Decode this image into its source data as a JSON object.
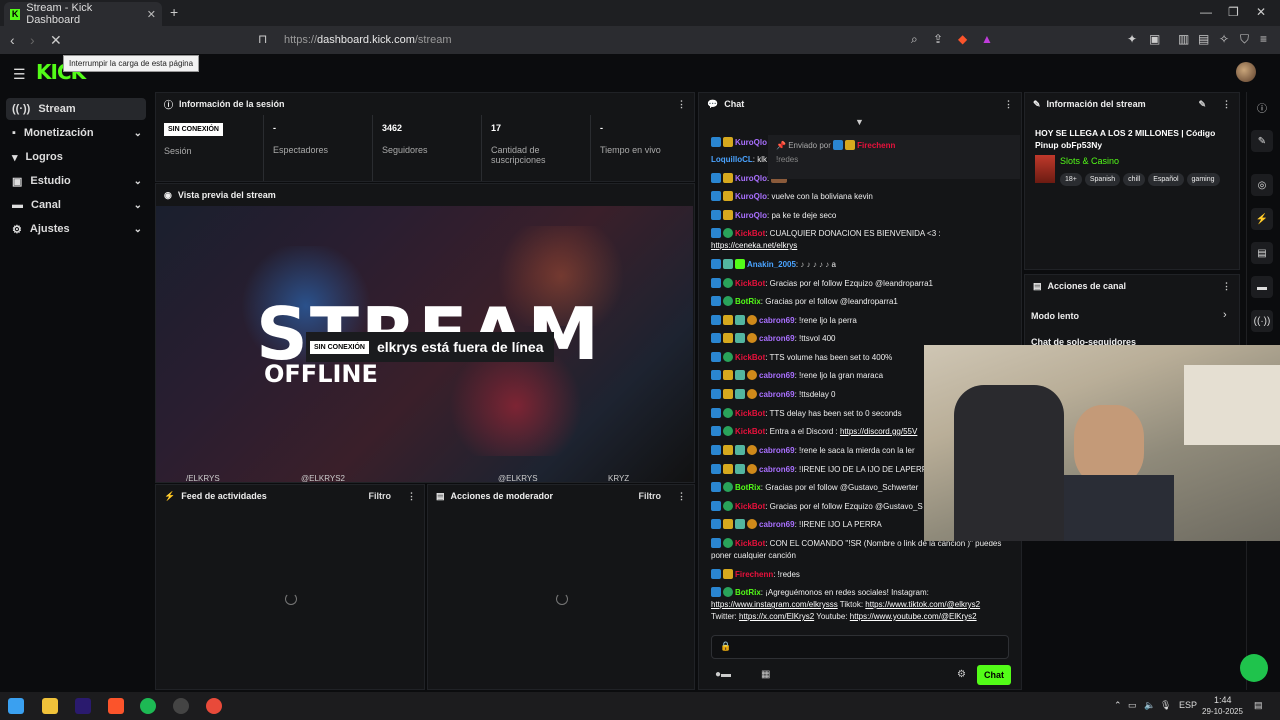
{
  "browser": {
    "tab_title": "Stream - Kick Dashboard",
    "url_prefix": "https://",
    "url_host": "dashboard.kick.com",
    "url_path": "/stream",
    "tooltip": "Interrumpir la carga de esta página"
  },
  "app": {
    "logo": "KICK"
  },
  "sidebar": {
    "items": [
      {
        "label": "Stream",
        "icon": "broadcast-icon",
        "active": true
      },
      {
        "label": "Monetización",
        "icon": "money-icon",
        "expandable": true
      },
      {
        "label": "Logros",
        "icon": "trophy-icon"
      },
      {
        "label": "Estudio",
        "icon": "studio-icon",
        "expandable": true
      },
      {
        "label": "Canal",
        "icon": "channel-icon",
        "expandable": true
      },
      {
        "label": "Ajustes",
        "icon": "gear-icon",
        "expandable": true
      }
    ]
  },
  "session": {
    "title": "Información de la sesión",
    "status_badge": "SIN CONEXIÓN",
    "status_label": "Sesión",
    "viewers_value": "-",
    "viewers_label": "Espectadores",
    "followers_value": "3462",
    "followers_label": "Seguidores",
    "subs_value": "17",
    "subs_label": "Cantidad de suscripciones",
    "live_value": "-",
    "live_label": "Tiempo en vivo"
  },
  "preview": {
    "title": "Vista previa del stream",
    "big_text": "STREAM",
    "big_sub": "OFFLINE",
    "offline_badge": "SIN CONEXIÓN",
    "offline_text": "elkrys está fuera de línea",
    "socials": [
      "/ELKRYS",
      "@ELKRYS2",
      "@ELKRYS",
      "KRYZ"
    ]
  },
  "activity": {
    "title": "Feed de actividades",
    "filter": "Filtro"
  },
  "moderator": {
    "title": "Acciones de moderador",
    "filter": "Filtro"
  },
  "chat": {
    "title": "Chat",
    "pinned_by_label": "Enviado por",
    "pinned_by_user": "Firechenn",
    "pinned_text": "!redes",
    "messages": [
      {
        "user": "KuroQlo",
        "color": "#a970ff",
        "text": ""
      },
      {
        "user": "LoquilloCL",
        "color": "#4aa3ff",
        "text": "klk"
      },
      {
        "user": "KuroQlo",
        "color": "#a970ff",
        "text": ""
      },
      {
        "user": "KuroQlo",
        "color": "#a970ff",
        "text": ": vuelve con la boliviana kevin"
      },
      {
        "user": "KuroQlo",
        "color": "#a970ff",
        "text": ": pa ke te deje seco"
      },
      {
        "user": "KickBot",
        "color": "#e9113c",
        "text": ": CUALQUIER DONACION ES BIENVENIDA <3 :",
        "link": "https://ceneka.net/elkrys"
      },
      {
        "user": "Anakin_2005",
        "color": "#4aa3ff",
        "text": ":",
        "tail": "a"
      },
      {
        "user": "KickBot",
        "color": "#e9113c",
        "text": ": Gracias por el follow Ezquizo @leandroparra1"
      },
      {
        "user": "BotRix",
        "color": "#53fc18",
        "text": ": Gracias por el follow @leandroparra1"
      },
      {
        "user": "cabron69",
        "color": "#a970ff",
        "text": ": !rene ljo la perra"
      },
      {
        "user": "cabron69",
        "color": "#a970ff",
        "text": ": !ttsvol 400"
      },
      {
        "user": "KickBot",
        "color": "#e9113c",
        "text": ": TTS volume has been set to 400%"
      },
      {
        "user": "cabron69",
        "color": "#a970ff",
        "text": ": !rene ljo la gran maraca"
      },
      {
        "user": "cabron69",
        "color": "#a970ff",
        "text": ": !ttsdelay 0"
      },
      {
        "user": "KickBot",
        "color": "#e9113c",
        "text": ": TTS delay has been set to 0 seconds"
      },
      {
        "user": "KickBot",
        "color": "#e9113c",
        "text": ": Entra a el Discord :",
        "link": "https://discord.gg/55V"
      },
      {
        "user": "cabron69",
        "color": "#a970ff",
        "text": ": !rene le saca la mierda con la ler"
      },
      {
        "user": "cabron69",
        "color": "#a970ff",
        "text": ": !IRENE IJO DE LA IJO DE LAPERR"
      },
      {
        "user": "BotRix",
        "color": "#53fc18",
        "text": ": Gracias por el follow @Gustavo_Schwerter"
      },
      {
        "user": "KickBot",
        "color": "#e9113c",
        "text": ": Gracias por el follow Ezquizo @Gustavo_S"
      },
      {
        "user": "cabron69",
        "color": "#a970ff",
        "text": ": !IRENE IJO LA PERRA"
      },
      {
        "user": "KickBot",
        "color": "#e9113c",
        "text": ": CON EL COMANDO \"!SR (Nombre o link de la canción )\" puedes poner cualquier canción"
      },
      {
        "user": "Firechenn",
        "color": "#e9113c",
        "text": ": !redes"
      },
      {
        "user": "BotRix",
        "color": "#53fc18",
        "text": ": ¡Agreguémonos en redes sociales! Instagram:",
        "line2": "Tiktok:",
        "line3": "Twitter:",
        "line3b": "Youtube:"
      }
    ],
    "links": {
      "instagram": "https://www.instagram.com/elkrysss",
      "tiktok": "https://www.tiktok.com/@elkrys2",
      "twitter": "https://x.com/ElKrys2",
      "youtube": "https://www.youtube.com/@ElKrys2"
    },
    "send_label": "Chat"
  },
  "stream_info": {
    "title": "Información del stream",
    "stream_title": "HOY SE LLEGA A LOS 2 MILLONES | Código Pinup obFp53Ny",
    "category": "Slots & Casino",
    "tags": [
      "18+",
      "Spanish",
      "chill",
      "Español",
      "gaming"
    ]
  },
  "channel_actions": {
    "title": "Acciones de canal",
    "items": [
      "Modo lento",
      "Chat de solo-seguidores"
    ]
  },
  "taskbar": {
    "lang": "ESP",
    "time": "1:44",
    "date": "29-10-2025"
  },
  "colors": {
    "brand": "#53fc18",
    "bg": "#0b0c0e",
    "panel": "#141517"
  }
}
